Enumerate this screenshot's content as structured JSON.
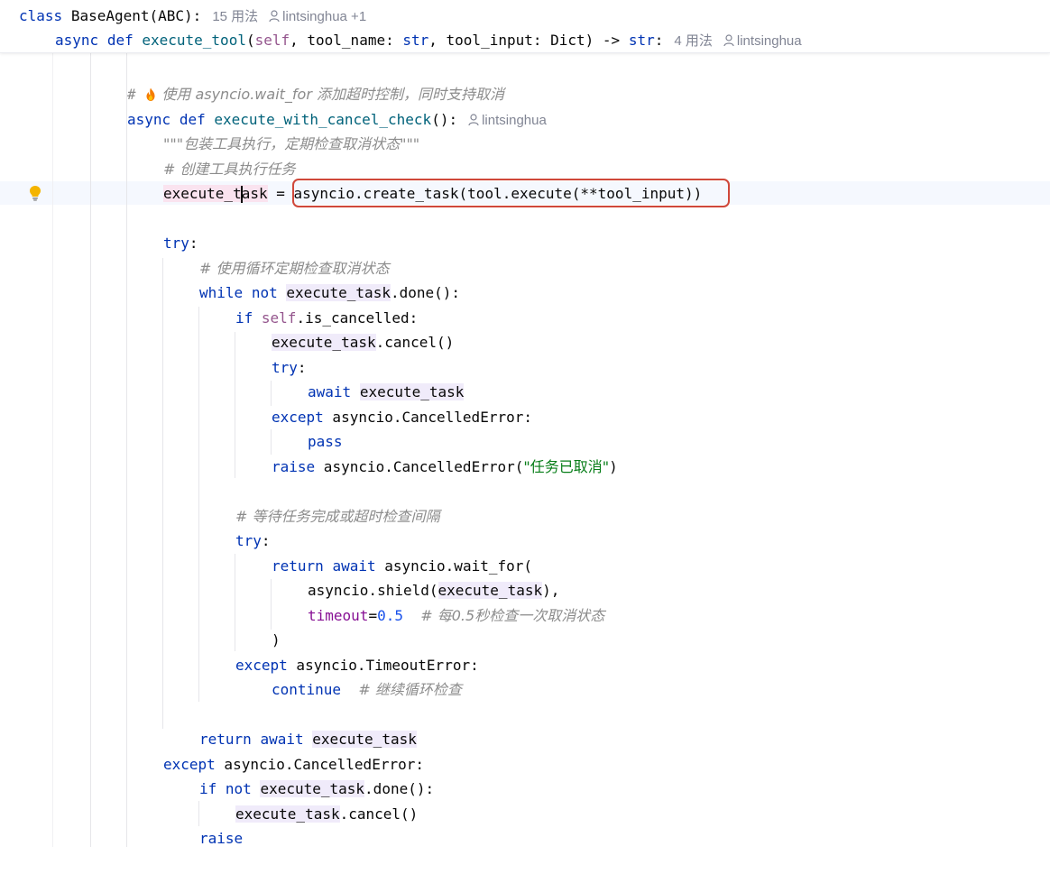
{
  "sticky_header": {
    "class_line": {
      "keyword": "class",
      "name": "BaseAgent",
      "args": "(ABC):",
      "usages": "15 用法",
      "author": "lintsinghua +1"
    },
    "method_line": {
      "keyword1": "async",
      "keyword2": "def",
      "name": "execute_tool",
      "open": "(",
      "self": "self",
      "p1": ", tool_name: ",
      "t1": "str",
      "p2": ", tool_input: Dict) -> ",
      "t2": "str",
      "colon": ":",
      "usages": "4 用法",
      "author": "lintsinghua"
    }
  },
  "code": {
    "l1_hash": "# ",
    "l1_text": " 使用 asyncio.wait_for 添加超时控制，同时支持取消",
    "l2_async": "async",
    "l2_def": "def",
    "l2_name": "execute_with_cancel_check",
    "l2_tail": "():",
    "l2_author": "lintsinghua",
    "l3_doc": "\"\"\"包装工具执行，定期检查取消状态\"\"\"",
    "l4_comment": "# 创建工具执行任务",
    "l5_var_a": "execute_t",
    "l5_var_b": "ask",
    "l5_eq": " = ",
    "l5_expr": "asyncio.create_task(tool.execute(**tool_input))",
    "l6_try": "try",
    "l6_colon": ":",
    "l7_comment": "# 使用循环定期检查取消状态",
    "l8_while": "while",
    "l8_not": "not",
    "l8_var": "execute_task",
    "l8_tail": ".done():",
    "l9_if": "if",
    "l9_self": "self",
    "l9_tail": ".is_cancelled:",
    "l10_var": "execute_task",
    "l10_tail": ".cancel()",
    "l11_try": "try",
    "l11_colon": ":",
    "l12_await": "await",
    "l12_var": "execute_task",
    "l13_except": "except",
    "l13_tail": " asyncio.CancelledError:",
    "l14_pass": "pass",
    "l15_raise": "raise",
    "l15_mid": " asyncio.CancelledError(",
    "l15_str": "\"任务已取消\"",
    "l15_end": ")",
    "l16_comment": "# 等待任务完成或超时检查间隔",
    "l17_try": "try",
    "l17_colon": ":",
    "l18_return": "return",
    "l18_await": "await",
    "l18_tail": " asyncio.wait_for(",
    "l19_head": "asyncio.shield(",
    "l19_var": "execute_task",
    "l19_tail": "),",
    "l20_param": "timeout",
    "l20_eq": "=",
    "l20_num": "0.5",
    "l20_comment": "# 每0.5秒检查一次取消状态",
    "l21_paren": ")",
    "l22_except": "except",
    "l22_tail": " asyncio.TimeoutError:",
    "l23_continue": "continue",
    "l23_comment": "# 继续循环检查",
    "l24_return": "return",
    "l24_await": "await",
    "l24_var": "execute_task",
    "l25_except": "except",
    "l25_tail": " asyncio.CancelledError:",
    "l26_if": "if",
    "l26_not": "not",
    "l26_var": "execute_task",
    "l26_tail": ".done():",
    "l27_var": "execute_task",
    "l27_tail": ".cancel()",
    "l28_raise": "raise"
  },
  "icons": {
    "bulb": "lightbulb-icon",
    "flame": "fire-icon",
    "user": "user-icon"
  },
  "colors": {
    "keyword": "#0033b3",
    "function": "#00627a",
    "self": "#94558d",
    "string": "#067d17",
    "number": "#1750eb",
    "comment": "#8c8c8c",
    "callout_border": "#d0483a"
  }
}
